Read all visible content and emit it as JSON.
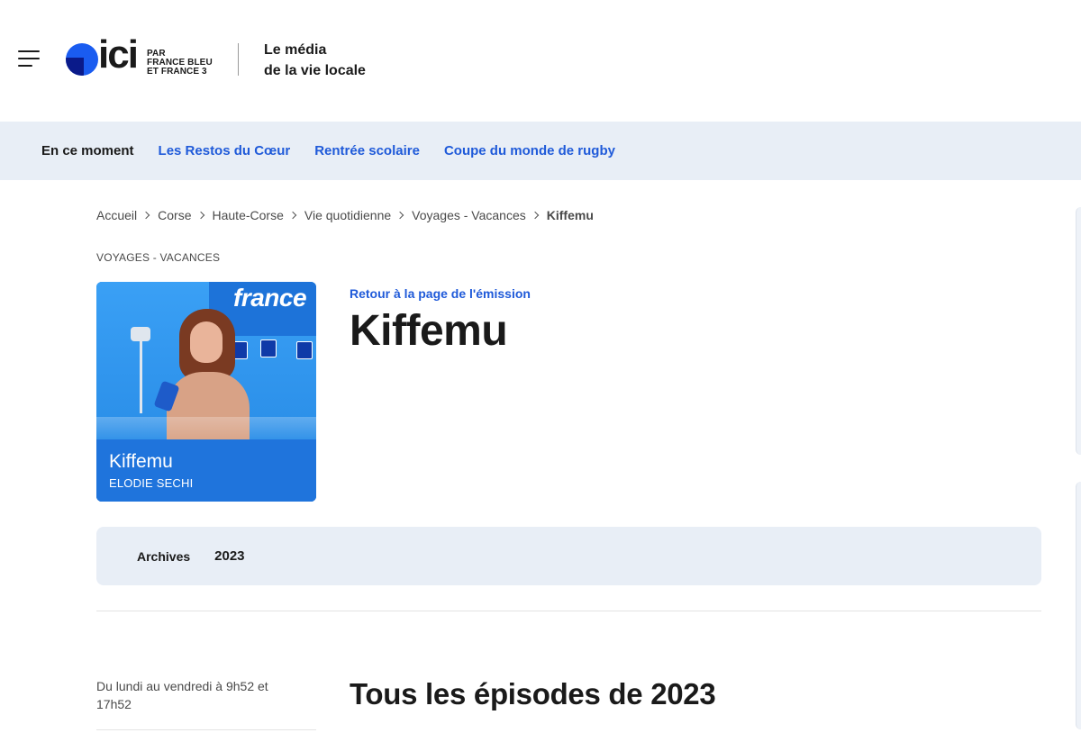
{
  "header": {
    "logo_word": "ici",
    "logo_sub": [
      "PAR",
      "FRANCE BLEU",
      "ET FRANCE 3"
    ],
    "tagline_line1": "Le média",
    "tagline_line2": "de la vie locale"
  },
  "trending": {
    "current": "En ce moment",
    "links": [
      "Les Restos du Cœur",
      "Rentrée scolaire",
      "Coupe du monde de rugby"
    ]
  },
  "breadcrumb": {
    "items": [
      "Accueil",
      "Corse",
      "Haute-Corse",
      "Vie quotidienne",
      "Voyages - Vacances"
    ],
    "current": "Kiffemu"
  },
  "kicker": "VOYAGES - VACANCES",
  "cover": {
    "brand": "france",
    "title": "Kiffemu",
    "author": "ELODIE SECHI"
  },
  "show": {
    "back_link": "Retour à la page de l'émission",
    "title": "Kiffemu"
  },
  "archives": {
    "label": "Archives",
    "year": "2023"
  },
  "schedule": "Du lundi au vendredi à 9h52 et 17h52",
  "episodes_title": "Tous les épisodes de 2023",
  "colors": {
    "link_blue": "#1f5ad9",
    "nav_bg": "#e8eef6",
    "brand_blue": "#1a5cf0"
  }
}
